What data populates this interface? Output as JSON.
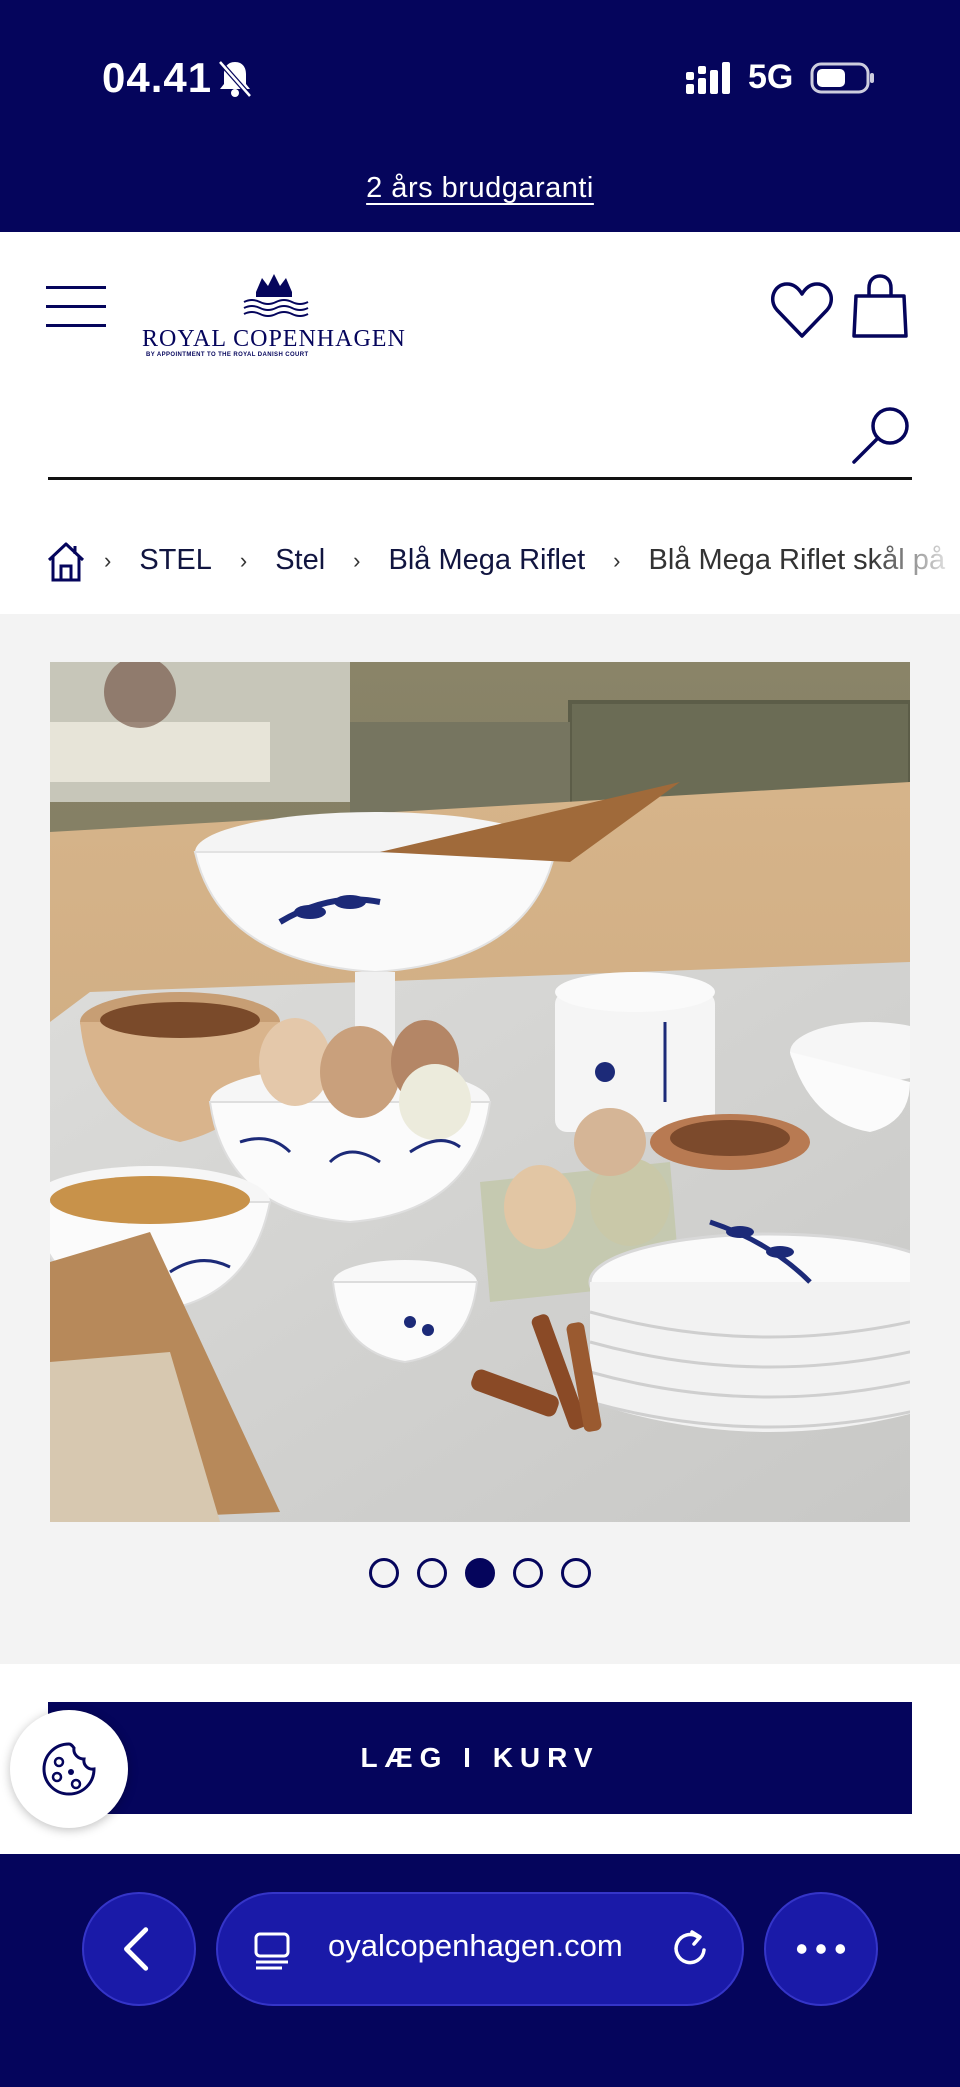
{
  "status_bar": {
    "time": "04.41",
    "network": "5G"
  },
  "promo": {
    "link": "2 års brudgaranti"
  },
  "header": {
    "logo_text": "ROYAL COPENHAGEN",
    "logo_subtitle": "BY APPOINTMENT TO THE ROYAL DANISH COURT"
  },
  "search": {
    "placeholder": "",
    "value": ""
  },
  "breadcrumb": {
    "items": [
      "STEL",
      "Stel",
      "Blå Mega Riflet",
      "Blå Mega Riflet skål på"
    ]
  },
  "gallery": {
    "slide_count": 5,
    "active_index": 3
  },
  "cta": {
    "add_to_cart": "LÆG I KURV"
  },
  "browser": {
    "url": "oyalcopenhagen.com"
  },
  "colors": {
    "brand_navy": "#05055c",
    "browser_button": "#1a1aa8",
    "gallery_bg": "#f3f3f3"
  },
  "icons": [
    "bell-slash-icon",
    "signal-icon",
    "battery-icon",
    "menu-icon",
    "crown-icon",
    "heart-icon",
    "bag-icon",
    "search-icon",
    "home-icon",
    "cookie-icon",
    "chevron-left-icon",
    "tabs-icon",
    "reload-icon",
    "more-icon"
  ]
}
